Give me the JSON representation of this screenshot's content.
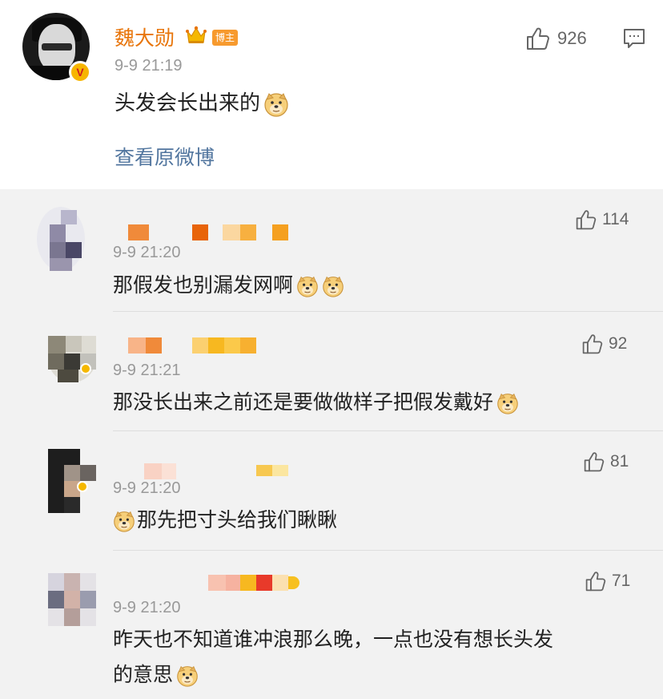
{
  "main_comment": {
    "username": "魏大勋",
    "owner_tag": "博主",
    "timestamp": "9-9 21:19",
    "text": "头发会长出来的",
    "like_count": "926",
    "view_original": "查看原微博",
    "verified_badge": "V"
  },
  "replies": [
    {
      "timestamp": "9-9 21:20",
      "text": "那假发也别漏发网啊",
      "like_count": "114",
      "emoji_count": 2
    },
    {
      "timestamp": "9-9 21:21",
      "text": "那没长出来之前还是要做做样子把假发戴好",
      "like_count": "92",
      "emoji_count": 1
    },
    {
      "timestamp": "9-9 21:20",
      "text": "那先把寸头给我们瞅瞅",
      "like_count": "81",
      "emoji_count": 1
    },
    {
      "timestamp": "9-9 21:20",
      "text_line1": "昨天也不知道谁冲浪那么晚，一点也没有想长头发",
      "text_line2": "的意思",
      "like_count": "71",
      "emoji_count": 1
    }
  ],
  "colors": {
    "username": "#e8750a",
    "link": "#52769f",
    "muted": "#999999",
    "owner_tag_bg": "#f79a2e",
    "page_bg": "#f2f2f2"
  },
  "icons": [
    "thumb-up-icon",
    "comment-icon",
    "crown-icon",
    "doge-emoji",
    "verified-badge-icon"
  ]
}
